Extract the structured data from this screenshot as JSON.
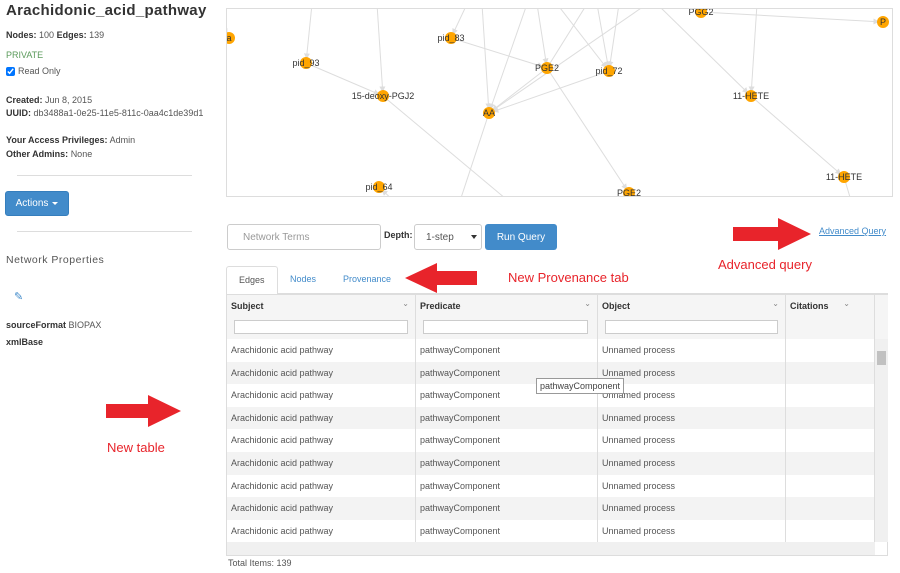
{
  "network": {
    "title": "Arachidonic_acid_pathway",
    "nodes_label": "Nodes:",
    "nodes": "100",
    "edges_label": "Edges:",
    "edges": "139",
    "visibility": "PRIVATE",
    "read_only_label": "Read Only",
    "read_only_checked": true,
    "created_label": "Created:",
    "created": "Jun 8, 2015",
    "uuid_label": "UUID:",
    "uuid": "db3488a1-0e25-11e5-811c-0aa4c1de39d1",
    "privileges_label": "Your Access Privileges:",
    "privileges": "Admin",
    "other_admins_label": "Other Admins:",
    "other_admins": "None"
  },
  "actions_label": "Actions",
  "properties": {
    "heading": "Network Properties",
    "items": [
      {
        "key": "sourceFormat",
        "value": "BIOPAX"
      },
      {
        "key": "xmlBase",
        "value": ""
      }
    ]
  },
  "graph": {
    "node_color": "#ffa500",
    "nodes": [
      "a",
      "pid_93",
      "pid_83",
      "PGE2",
      "pid_72",
      "PGG2",
      "P",
      "15-deoxy-PGJ2",
      "AA",
      "11-HETE",
      "11-HETE",
      "pid_64",
      "PGE2"
    ],
    "edges": [
      [
        1,
        7
      ],
      [
        2,
        3
      ],
      [
        3,
        8
      ],
      [
        4,
        8
      ],
      [
        3,
        12
      ],
      [
        9,
        10
      ],
      [
        5,
        6
      ]
    ]
  },
  "query": {
    "placeholder": "Network Terms",
    "depth_label": "Depth:",
    "depth_value": "1-step",
    "run_label": "Run Query",
    "advanced_label": "Advanced Query"
  },
  "annotations": {
    "advanced": "Advanced query",
    "provenance": "New Provenance tab",
    "table": "New table",
    "arrow_color": "#e8242b"
  },
  "tabs": [
    {
      "label": "Edges",
      "active": true
    },
    {
      "label": "Nodes",
      "active": false
    },
    {
      "label": "Provenance",
      "active": false
    }
  ],
  "table": {
    "columns": [
      "Subject",
      "Predicate",
      "Object",
      "Citations"
    ],
    "rows": [
      [
        "Arachidonic acid pathway",
        "pathwayComponent",
        "Unnamed process",
        ""
      ],
      [
        "Arachidonic acid pathway",
        "pathwayComponent",
        "Unnamed process",
        ""
      ],
      [
        "Arachidonic acid pathway",
        "pathwayComponent",
        "Unnamed process",
        ""
      ],
      [
        "Arachidonic acid pathway",
        "pathwayComponent",
        "Unnamed process",
        ""
      ],
      [
        "Arachidonic acid pathway",
        "pathwayComponent",
        "Unnamed process",
        ""
      ],
      [
        "Arachidonic acid pathway",
        "pathwayComponent",
        "Unnamed process",
        ""
      ],
      [
        "Arachidonic acid pathway",
        "pathwayComponent",
        "Unnamed process",
        ""
      ],
      [
        "Arachidonic acid pathway",
        "pathwayComponent",
        "Unnamed process",
        ""
      ],
      [
        "Arachidonic acid pathway",
        "pathwayComponent",
        "Unnamed process",
        ""
      ]
    ],
    "tooltip": "pathwayComponent",
    "total_label": "Total Items: 139"
  }
}
